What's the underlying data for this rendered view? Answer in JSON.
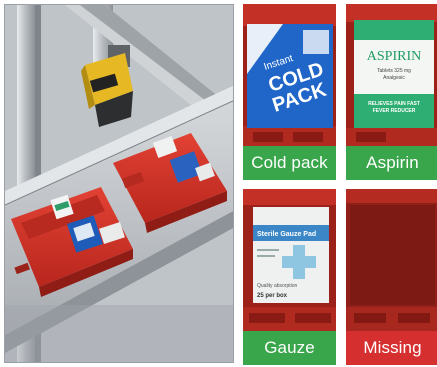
{
  "tiles": {
    "cold_pack": {
      "caption": "Cold pack",
      "status": "ok",
      "box_text_1": "Instant",
      "box_text_2": "COLD",
      "box_text_3": "PACK"
    },
    "aspirin": {
      "caption": "Aspirin",
      "status": "ok",
      "box_title": "ASPIRIN",
      "box_sub_1": "Tablets 325 mg",
      "box_sub_2": "Analgesic",
      "box_sub_3": "RELIEVES PAIN FAST",
      "box_sub_4": "FEVER REDUCER"
    },
    "gauze": {
      "caption": "Gauze",
      "status": "ok",
      "box_title": "Sterile Gauze Pad",
      "box_line_1": "Quality absorption",
      "box_line_2": "25 per box"
    },
    "missing": {
      "caption": "Missing",
      "status": "missing"
    }
  },
  "colors": {
    "ok": "#3aa64b",
    "missing": "#d62f2f",
    "tray": "#d8352a",
    "camera": "#e5b824"
  }
}
